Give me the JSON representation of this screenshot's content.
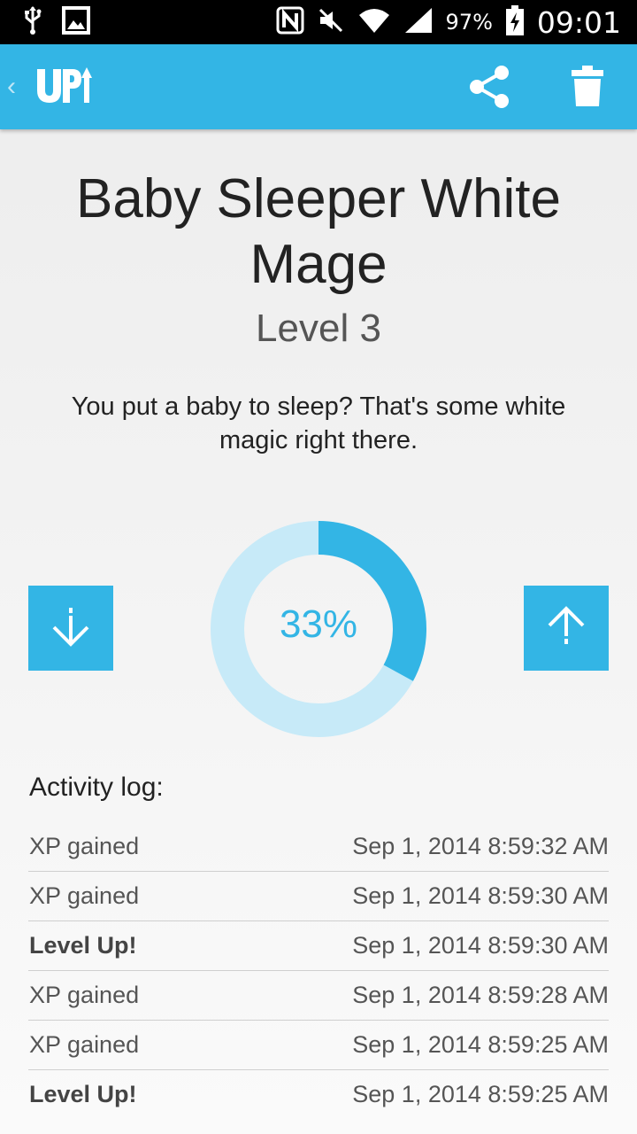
{
  "status_bar": {
    "battery": "97%",
    "time": "09:01",
    "icons": [
      "usb-icon",
      "image-icon",
      "nfc-icon",
      "mute-icon",
      "wifi-icon",
      "signal-icon",
      "battery-icon"
    ]
  },
  "app_bar": {
    "logo": "UP",
    "actions": [
      "share-icon",
      "trash-icon"
    ],
    "accent": "#33b5e5"
  },
  "skill": {
    "title": "Baby Sleeper White Mage",
    "level": "Level 3",
    "description": "You put a baby to sleep? That's some white magic right there.",
    "progress_label": "33%",
    "progress": 0.33
  },
  "activity": {
    "heading": "Activity log:",
    "rows": [
      {
        "event": "XP gained",
        "time": "Sep 1, 2014 8:59:32 AM",
        "bold": false
      },
      {
        "event": "XP gained",
        "time": "Sep 1, 2014 8:59:30 AM",
        "bold": false
      },
      {
        "event": "Level Up!",
        "time": "Sep 1, 2014 8:59:30 AM",
        "bold": true
      },
      {
        "event": "XP gained",
        "time": "Sep 1, 2014 8:59:28 AM",
        "bold": false
      },
      {
        "event": "XP gained",
        "time": "Sep 1, 2014 8:59:25 AM",
        "bold": false
      },
      {
        "event": "Level Up!",
        "time": "Sep 1, 2014 8:59:25 AM",
        "bold": true
      }
    ]
  }
}
